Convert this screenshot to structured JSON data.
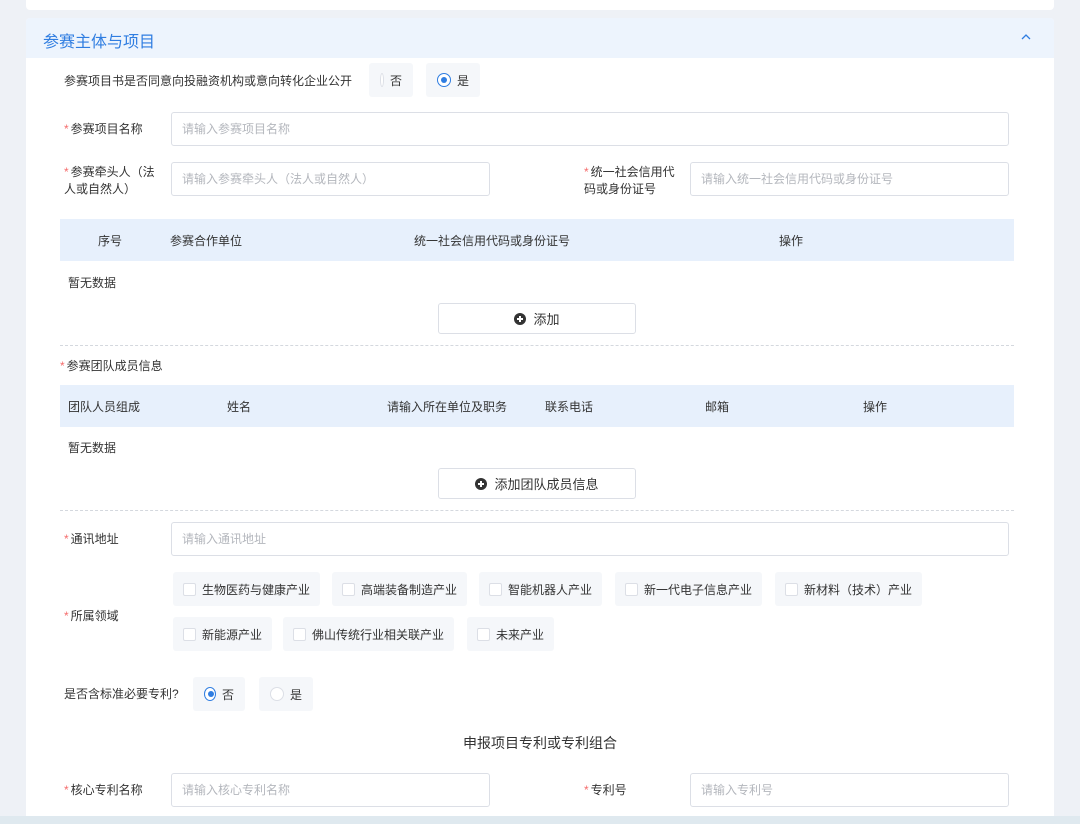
{
  "section": {
    "title": "参赛主体与项目"
  },
  "disclosure": {
    "label": "参赛项目书是否同意向投融资机构或意向转化企业公开",
    "options": [
      "否",
      "是"
    ],
    "selected": "是"
  },
  "project_name": {
    "label": "参赛项目名称",
    "placeholder": "请输入参赛项目名称"
  },
  "lead": {
    "label_line1": "参赛牵头人（法",
    "label_line2": "人或自然人）",
    "placeholder": "请输入参赛牵头人（法人或自然人）"
  },
  "credit_code": {
    "label_line1": "统一社会信用代",
    "label_line2": "码或身份证号",
    "placeholder": "请输入统一社会信用代码或身份证号"
  },
  "partners_table": {
    "headers": [
      "序号",
      "参赛合作单位",
      "统一社会信用代码或身份证号",
      "操作"
    ],
    "empty_text": "暂无数据",
    "add_label": "添加"
  },
  "team": {
    "label": "参赛团队成员信息",
    "headers": [
      "团队人员组成",
      "姓名",
      "请输入所在单位及职务",
      "联系电话",
      "邮箱",
      "操作"
    ],
    "empty_text": "暂无数据",
    "add_label": "添加团队成员信息"
  },
  "address": {
    "label": "通讯地址",
    "placeholder": "请输入通讯地址"
  },
  "field": {
    "label": "所属领域",
    "options": [
      "生物医药与健康产业",
      "高端装备制造产业",
      "智能机器人产业",
      "新一代电子信息产业",
      "新材料（技术）产业",
      "新能源产业",
      "佛山传统行业相关联产业",
      "未来产业"
    ]
  },
  "patent": {
    "label": "是否含标准必要专利?",
    "options": [
      "否",
      "是"
    ],
    "selected": "否"
  },
  "patent_section": {
    "title": "申报项目专利或专利组合"
  },
  "core_patent": {
    "label": "核心专利名称",
    "placeholder": "请输入核心专利名称"
  },
  "patent_no": {
    "label": "专利号",
    "placeholder": "请输入专利号"
  },
  "colors": {
    "accent": "#2f7de1",
    "required": "#f56c6c",
    "header_bg": "#edf4fd",
    "table_head_bg": "#e7f0fc"
  }
}
